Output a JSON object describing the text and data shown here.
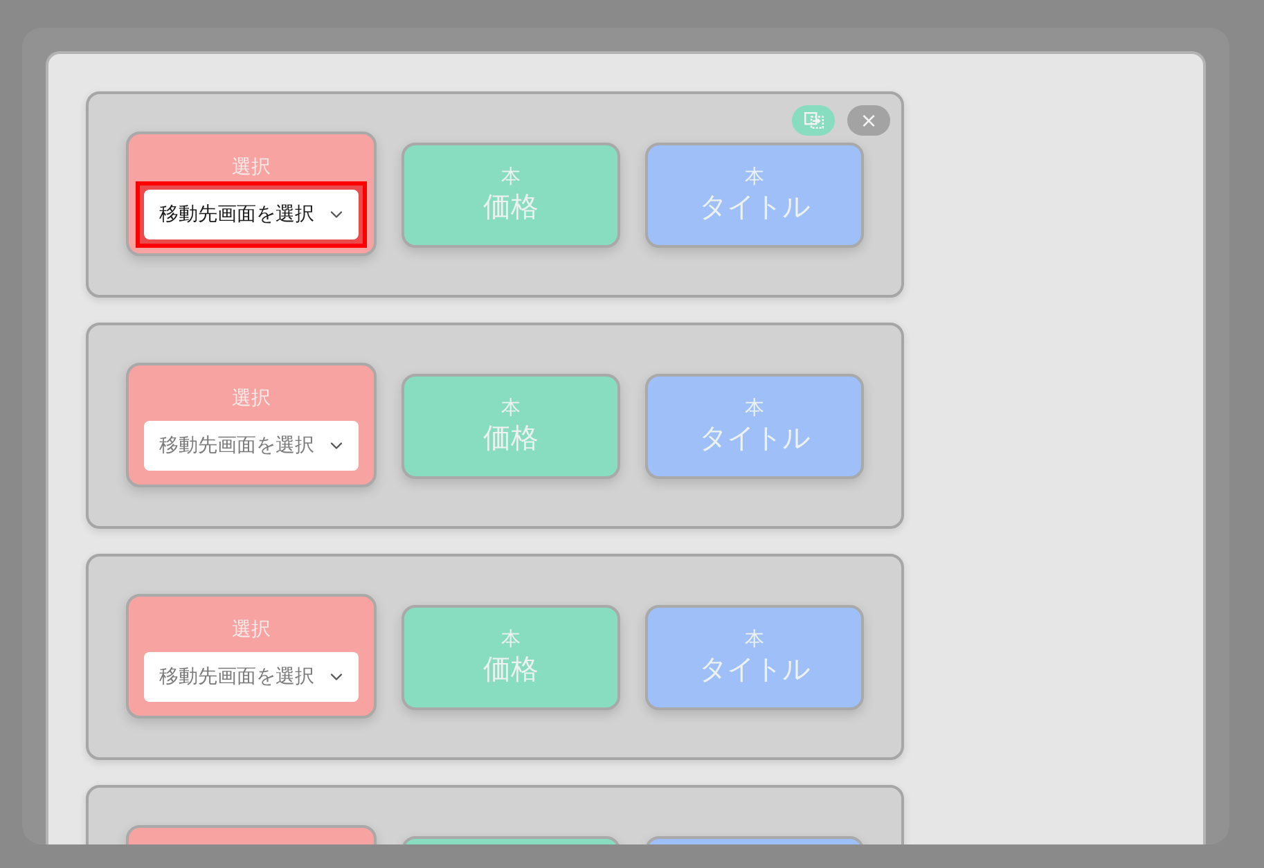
{
  "card_actions": [
    {
      "kind": "duplicate"
    },
    {
      "kind": "close",
      "label": "×"
    }
  ],
  "cards": [
    {
      "selected": true,
      "blocks": [
        {
          "kind": "select",
          "color": "#f7a3a1",
          "label": "選択",
          "dropdown": {
            "placeholder": "移動先画面を選択",
            "focused": true
          }
        },
        {
          "kind": "field",
          "color": "#88dcc0",
          "caption": "本",
          "title": "価格"
        },
        {
          "kind": "field",
          "color": "#9fbff9",
          "caption": "本",
          "title": "タイトル"
        }
      ]
    },
    {
      "selected": false,
      "blocks": [
        {
          "kind": "select",
          "color": "#f7a3a1",
          "label": "選択",
          "dropdown": {
            "placeholder": "移動先画面を選択",
            "focused": false
          }
        },
        {
          "kind": "field",
          "color": "#88dcc0",
          "caption": "本",
          "title": "価格"
        },
        {
          "kind": "field",
          "color": "#9fbff9",
          "caption": "本",
          "title": "タイトル"
        }
      ]
    },
    {
      "selected": false,
      "blocks": [
        {
          "kind": "select",
          "color": "#f7a3a1",
          "label": "選択",
          "dropdown": {
            "placeholder": "移動先画面を選択",
            "focused": false
          }
        },
        {
          "kind": "field",
          "color": "#88dcc0",
          "caption": "本",
          "title": "価格"
        },
        {
          "kind": "field",
          "color": "#9fbff9",
          "caption": "本",
          "title": "タイトル"
        }
      ]
    },
    {
      "selected": false,
      "blocks": [
        {
          "kind": "select",
          "color": "#f7a3a1"
        },
        {
          "kind": "field",
          "color": "#88dcc0"
        },
        {
          "kind": "field",
          "color": "#9fbff9"
        }
      ]
    }
  ]
}
